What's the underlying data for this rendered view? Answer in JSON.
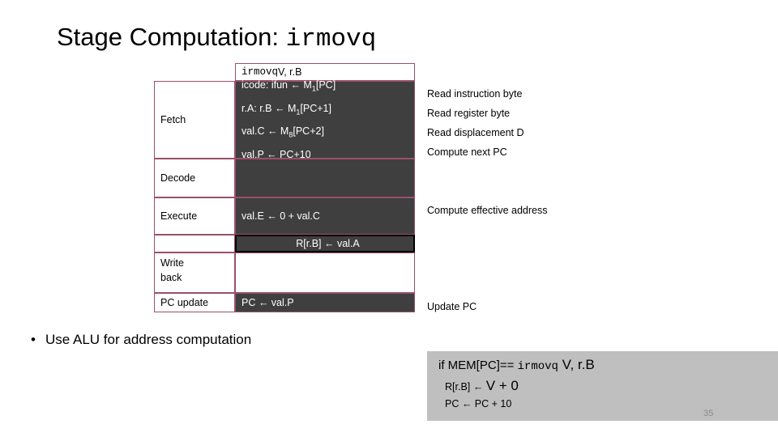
{
  "slide": {
    "title_prefix": "Stage Computation: ",
    "title_mono": "irmovq",
    "page_number": "35"
  },
  "table": {
    "header": {
      "mono": "irmovq",
      "rest": " V, r.B"
    },
    "rows": [
      {
        "stage": "Fetch",
        "lines": [
          "icode: ifun ← M1[PC]",
          "r.A: r.B ← M1[PC+1]",
          "val.C ← M8[PC+2]",
          "val.P ← PC+10"
        ],
        "comments": [
          "Read instruction byte",
          "Read register byte",
          "Read displacement D",
          "Compute next PC"
        ]
      },
      {
        "stage": "Decode",
        "lines": [],
        "comments": []
      },
      {
        "stage": "Execute",
        "lines": [
          "val.E ← 0 + val.C"
        ],
        "comments": [
          "Compute effective address"
        ]
      },
      {
        "stage": "Write back",
        "lines": [
          "R[r.B] ← val.A"
        ],
        "comments": []
      },
      {
        "stage": "PC update",
        "lines": [
          "PC ← val.P"
        ],
        "comments": [
          "Update PC"
        ]
      }
    ]
  },
  "bullet": {
    "marker": "•",
    "text": "Use ALU for address computation"
  },
  "graybox": {
    "line1_pre": "if MEM[PC]== ",
    "line1_mono": "irmovq",
    "line1_post": " V, r.B",
    "line2_pre": "R[r.B] ← ",
    "line2_val": "V + 0",
    "line3": "PC ← PC + 10"
  }
}
